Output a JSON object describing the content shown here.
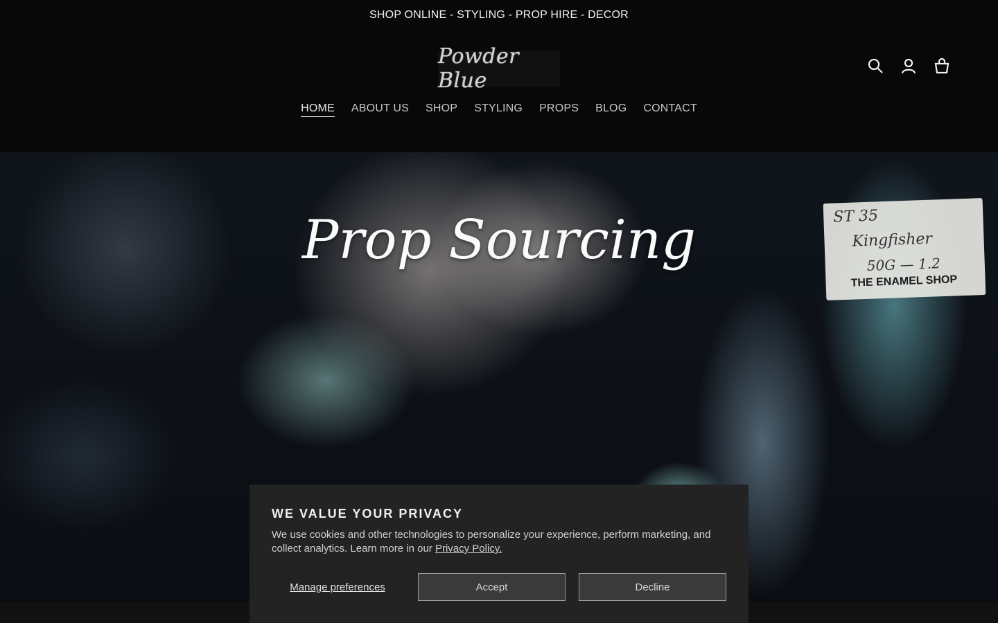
{
  "announcement": {
    "text": "SHOP ONLINE - STYLING - PROP HIRE - DECOR"
  },
  "header": {
    "logo_text": "Powder Blue",
    "icons": [
      "search-icon",
      "account-icon",
      "cart-icon"
    ]
  },
  "nav": {
    "items": [
      {
        "label": "HOME",
        "active": true
      },
      {
        "label": "ABOUT US",
        "active": false
      },
      {
        "label": "SHOP",
        "active": false
      },
      {
        "label": "STYLING",
        "active": false
      },
      {
        "label": "PROPS",
        "active": false
      },
      {
        "label": "BLOG",
        "active": false
      },
      {
        "label": "CONTACT",
        "active": false
      }
    ]
  },
  "hero": {
    "title": "Prop Sourcing",
    "label_lines": [
      "ST 35",
      "Kingfisher",
      "50G — 1.2",
      "THE ENAMEL SHOP"
    ]
  },
  "cookie": {
    "title": "WE VALUE YOUR PRIVACY",
    "body": "We use cookies and other technologies to personalize your experience, perform marketing, and collect analytics. Learn more in our ",
    "link": "Privacy Policy.",
    "manage_label": "Manage preferences",
    "accept_label": "Accept",
    "decline_label": "Decline"
  },
  "colors": {
    "background": "#080808",
    "banner": "#232323",
    "button": "#3a3a3a"
  }
}
